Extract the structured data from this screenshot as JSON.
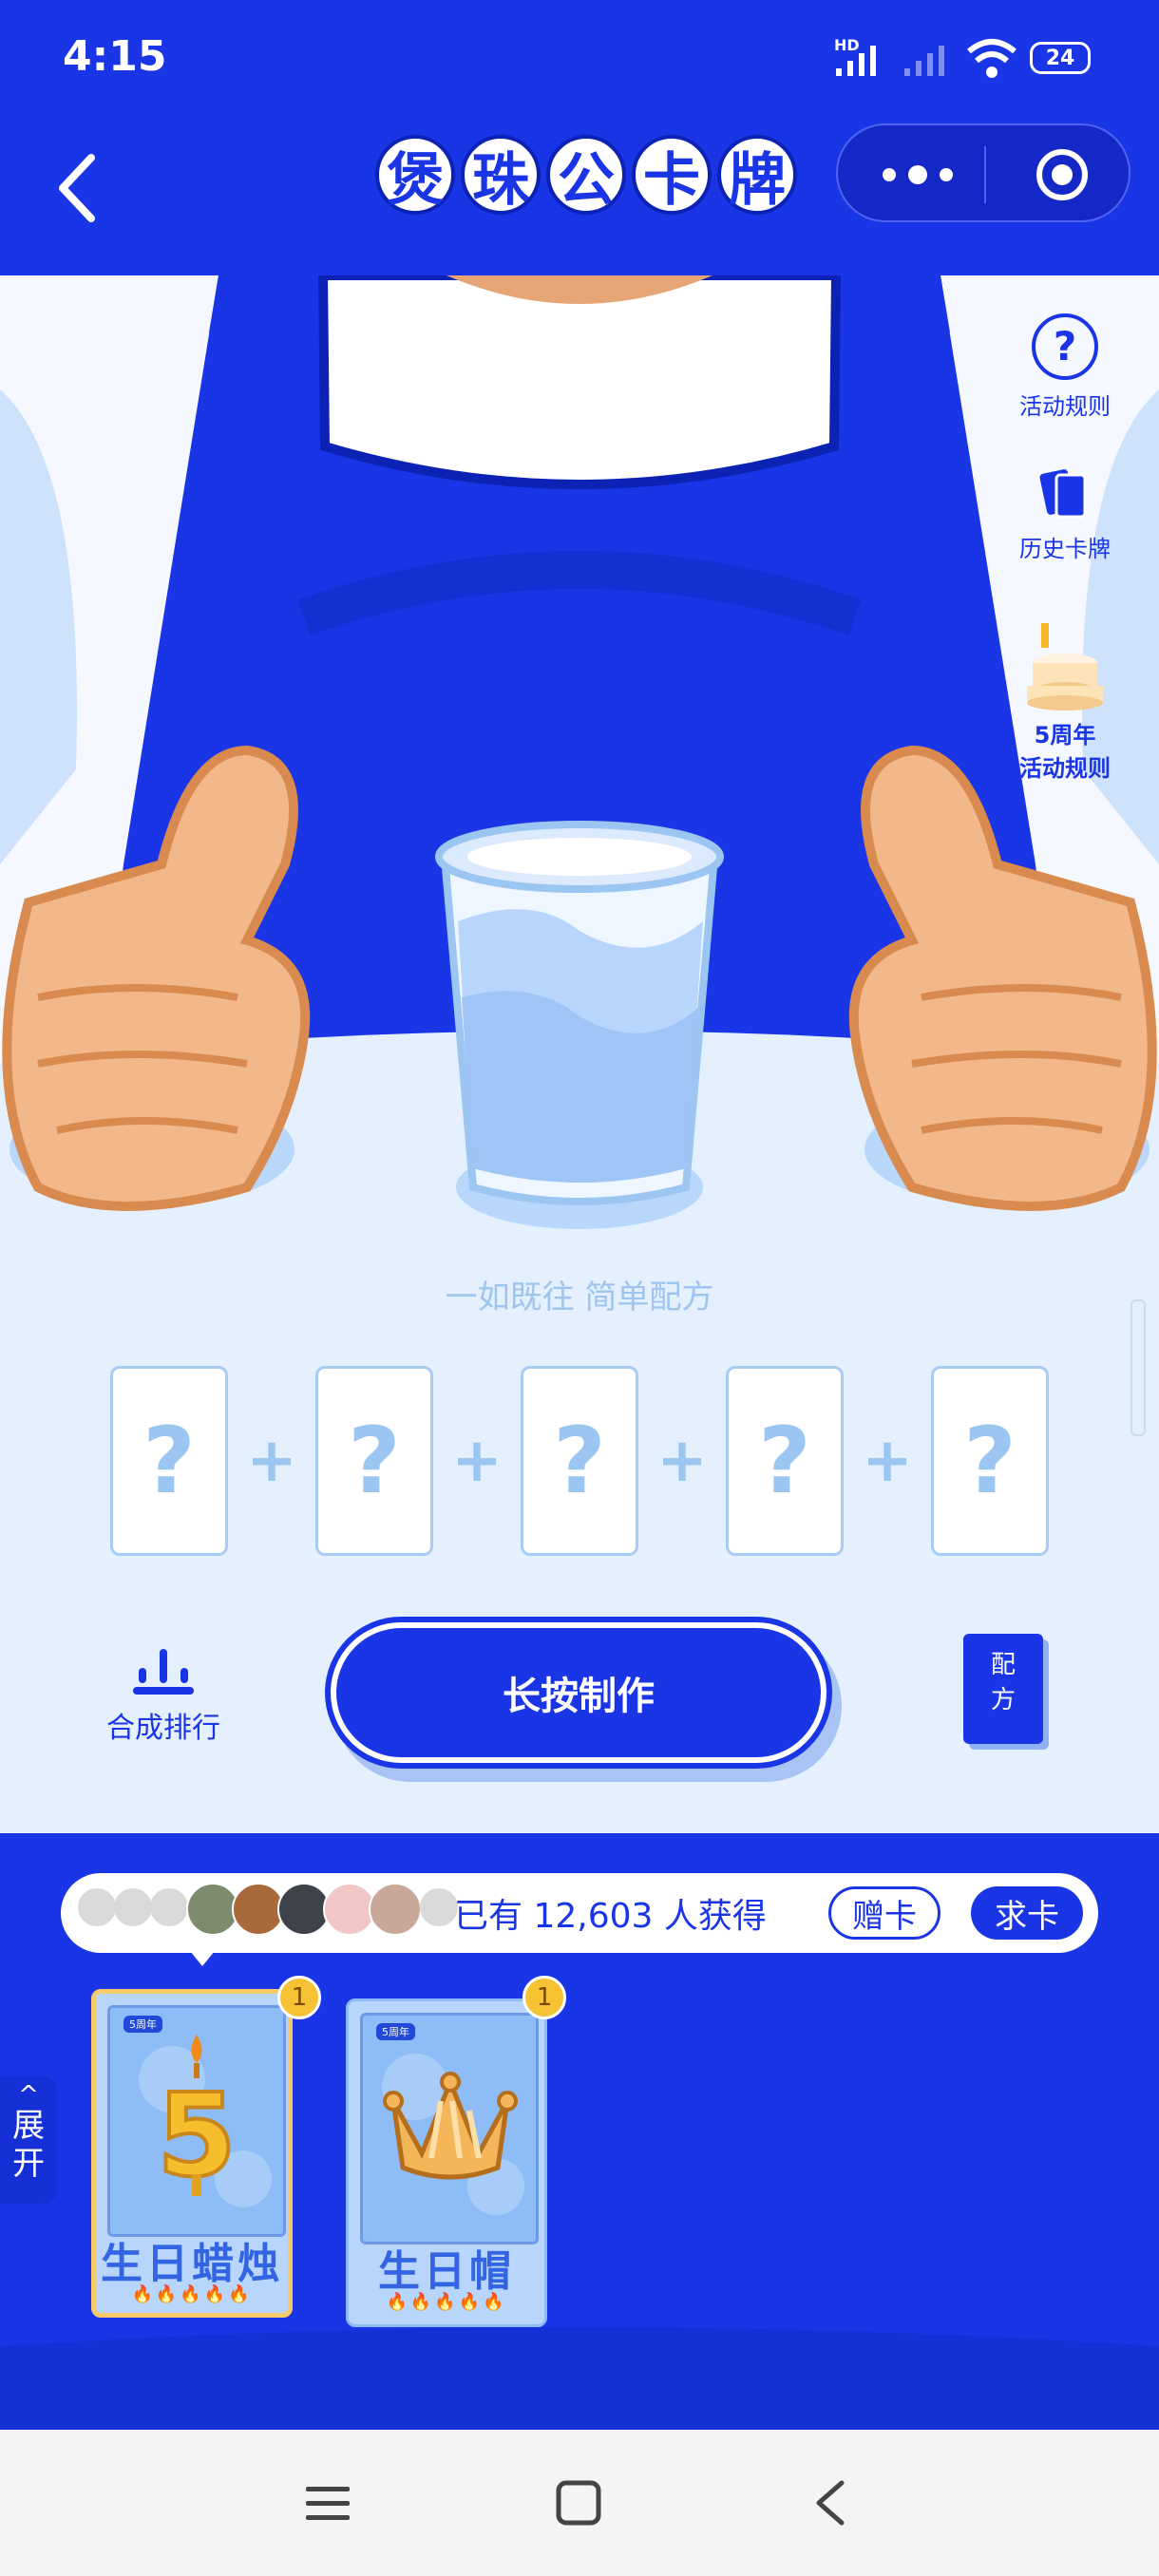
{
  "status_bar": {
    "time": "4:15",
    "network": "HD",
    "battery": "24"
  },
  "header": {
    "title_chars": [
      "煲",
      "珠",
      "公",
      "卡",
      "牌"
    ]
  },
  "side_menu": {
    "rules": "活动规则",
    "history": "历史卡牌",
    "anniversary_line1": "5周年",
    "anniversary_line2": "活动规则"
  },
  "scene": {
    "slogan": "一如既往 简单配方"
  },
  "recipe": {
    "slots": [
      "?",
      "?",
      "?",
      "?",
      "?"
    ],
    "plus": "+"
  },
  "actions": {
    "ranking": "合成排行",
    "make": "长按制作",
    "book_line1": "配",
    "book_line2": "方"
  },
  "owners": {
    "text": "已有 12,603 人获得",
    "gift": "赠卡",
    "request": "求卡"
  },
  "expand": {
    "arrow": "^",
    "line1": "展",
    "line2": "开"
  },
  "cards": [
    {
      "tag": "5周年",
      "name": "生日蜡烛",
      "count": "1",
      "fire": "🔥🔥🔥🔥🔥"
    },
    {
      "tag": "5周年",
      "name": "生日帽",
      "count": "1",
      "fire": "🔥🔥🔥🔥🔥"
    }
  ]
}
